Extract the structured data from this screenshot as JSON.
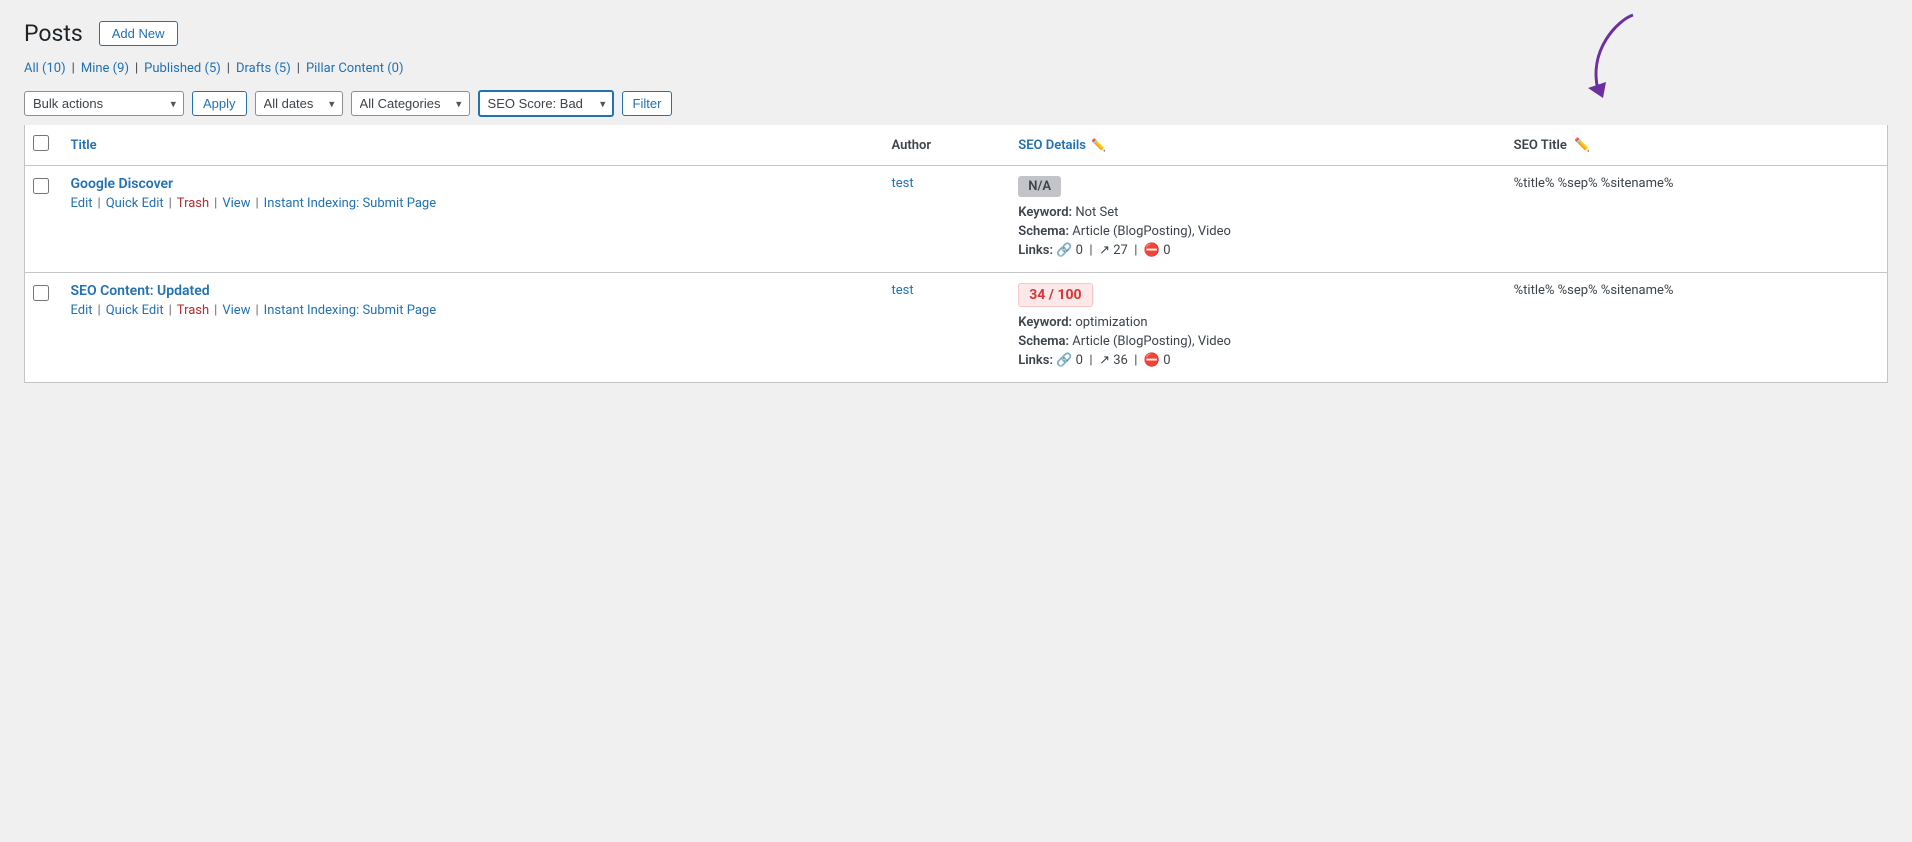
{
  "page": {
    "title": "Posts",
    "add_new_label": "Add New"
  },
  "filters": {
    "all_label": "All",
    "all_count": "10",
    "mine_label": "Mine",
    "mine_count": "9",
    "published_label": "Published",
    "published_count": "5",
    "drafts_label": "Drafts",
    "drafts_count": "5",
    "pillar_label": "Pillar Content",
    "pillar_count": "0"
  },
  "toolbar": {
    "bulk_actions_label": "Bulk actions",
    "apply_label": "Apply",
    "all_dates_label": "All dates",
    "all_categories_label": "All Categories",
    "seo_score_label": "SEO Score: Bad",
    "filter_label": "Filter"
  },
  "table": {
    "col_title": "Title",
    "col_author": "Author",
    "col_seo_details": "SEO Details",
    "col_seo_title": "SEO Title"
  },
  "posts": [
    {
      "title": "Google Discover",
      "edit_label": "Edit",
      "quick_edit_label": "Quick Edit",
      "trash_label": "Trash",
      "view_label": "View",
      "instant_indexing_label": "Instant Indexing: Submit Page",
      "author": "test",
      "seo_score_display": "N/A",
      "seo_score_type": "na",
      "keyword_label": "Keyword:",
      "keyword_value": "Not Set",
      "schema_label": "Schema:",
      "schema_value": "Article (BlogPosting), Video",
      "links_label": "Links:",
      "links_internal": "0",
      "links_external": "27",
      "links_nofollow": "0",
      "seo_title_value": "%title% %sep% %sitename%"
    },
    {
      "title": "SEO Content: Updated",
      "edit_label": "Edit",
      "quick_edit_label": "Quick Edit",
      "trash_label": "Trash",
      "view_label": "View",
      "instant_indexing_label": "Instant Indexing: Submit Page",
      "author": "test",
      "seo_score_display": "34 / 100",
      "seo_score_type": "bad",
      "keyword_label": "Keyword:",
      "keyword_value": "optimization",
      "schema_label": "Schema:",
      "schema_value": "Article (BlogPosting), Video",
      "links_label": "Links:",
      "links_internal": "0",
      "links_external": "36",
      "links_nofollow": "0",
      "seo_title_value": "%title% %sep% %sitename%"
    }
  ],
  "arrow": {
    "color": "#6b2fa0"
  }
}
